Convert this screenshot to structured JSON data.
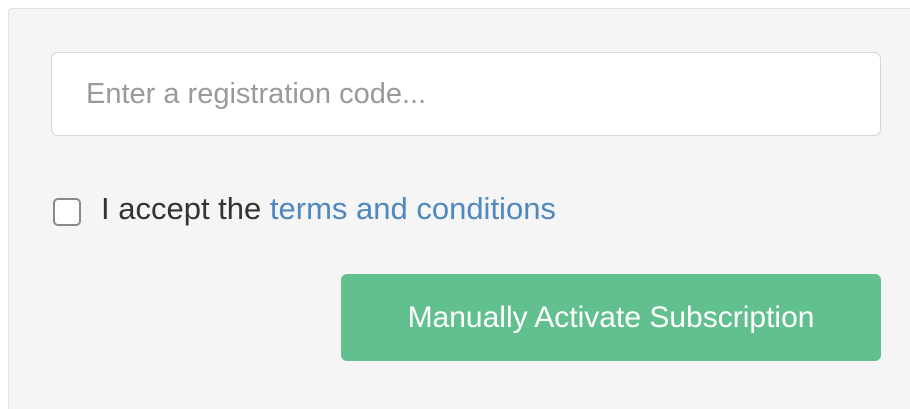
{
  "registration": {
    "code_value": "",
    "code_placeholder": "Enter a registration code...",
    "terms_prefix": "I accept the ",
    "terms_link_label": "terms and conditions",
    "terms_checked": false,
    "activate_label": "Manually Activate Subscription"
  },
  "colors": {
    "link": "#4f87bf",
    "button": "#62c08f",
    "panel_background": "#f5f5f5"
  }
}
